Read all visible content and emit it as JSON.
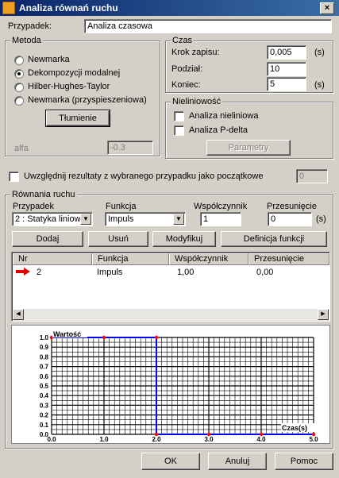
{
  "window": {
    "title": "Analiza równań ruchu",
    "close": "×"
  },
  "przypadek": {
    "label": "Przypadek:",
    "value": "Analiza czasowa"
  },
  "metoda": {
    "legend": "Metoda",
    "options": [
      "Newmarka",
      "Dekompozycji modalnej",
      "Hilber-Hughes-Taylor",
      "Newmarka (przyspieszeniowa)"
    ],
    "selected": 1,
    "tlumienie": "Tłumienie",
    "alfa_label": "alfa",
    "alfa_value": "-0.3"
  },
  "czas": {
    "legend": "Czas",
    "krok_label": "Krok zapisu:",
    "krok_value": "0,005",
    "krok_unit": "(s)",
    "podzial_label": "Podział:",
    "podzial_value": "10",
    "koniec_label": "Koniec:",
    "koniec_value": "5",
    "koniec_unit": "(s)"
  },
  "nieliniowosc": {
    "legend": "Nieliniowość",
    "opt1": "Analiza nieliniowa",
    "opt2": "Analiza P-delta",
    "parametry": "Parametry"
  },
  "uwzglednij": {
    "label": "Uwzględnij rezultaty z wybranego przypadku jako początkowe",
    "value": "0"
  },
  "rownania": {
    "legend": "Równania ruchu",
    "przypadek_label": "Przypadek",
    "przypadek_value": "2 : Statyka liniow",
    "funkcja_label": "Funkcja",
    "funkcja_value": "Impuls",
    "wsp_label": "Współczynnik",
    "wsp_value": "1",
    "przes_label": "Przesunięcie",
    "przes_value": "0",
    "przes_unit": "(s)",
    "dodaj": "Dodaj",
    "usun": "Usuń",
    "modyfikuj": "Modyfikuj",
    "definicja": "Definicja funkcji"
  },
  "table": {
    "headers": [
      "Nr",
      "Funkcja",
      "Współczynnik",
      "Przesunięcie"
    ],
    "rows": [
      [
        "2",
        "Impuls",
        "1,00",
        "0,00"
      ]
    ]
  },
  "chart_data": {
    "type": "line",
    "ylabel": "Wartość",
    "xlabel": "Czas(s)",
    "xlim": [
      0,
      5
    ],
    "ylim": [
      0,
      1
    ],
    "xticks": [
      "0.0",
      "1.0",
      "2.0",
      "3.0",
      "4.0",
      "5.0"
    ],
    "yticks": [
      "0.0",
      "0.1",
      "0.2",
      "0.3",
      "0.4",
      "0.5",
      "0.6",
      "0.7",
      "0.8",
      "0.9",
      "1.0"
    ],
    "series": [
      {
        "x": [
          0,
          1,
          2,
          2,
          3,
          4,
          5
        ],
        "y": [
          1,
          1,
          1,
          0,
          0,
          0,
          0
        ],
        "color": "#0000ff"
      }
    ],
    "grid": true
  },
  "footer": {
    "ok": "OK",
    "anuluj": "Anuluj",
    "pomoc": "Pomoc"
  }
}
